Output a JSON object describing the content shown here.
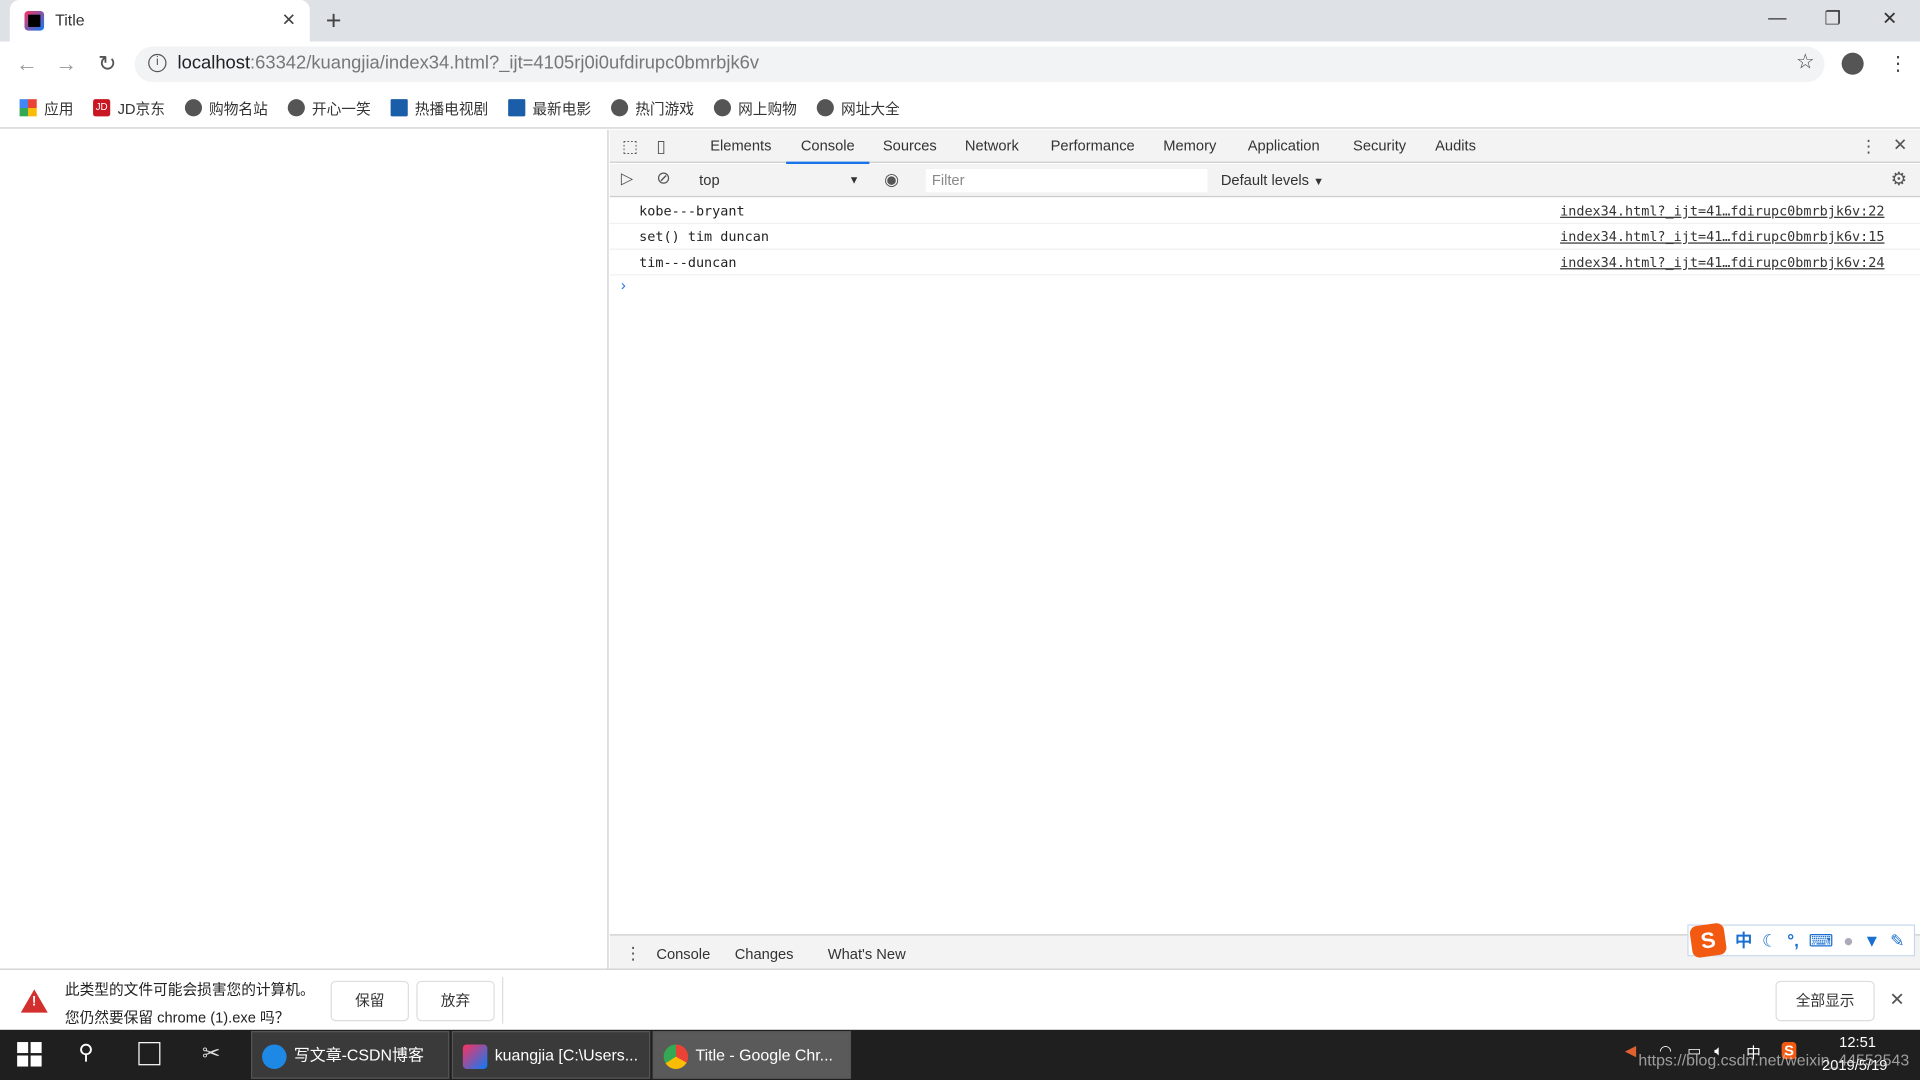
{
  "browser": {
    "tab_title": "Title",
    "url_host": "localhost",
    "url_rest": ":63342/kuangjia/index34.html?_ijt=4105rj0i0ufdirupc0bmrbjk6v",
    "bookmarks": [
      "应用",
      "JD京东",
      "购物名站",
      "开心一笑",
      "热播电视剧",
      "最新电影",
      "热门游戏",
      "网上购物",
      "网址大全"
    ]
  },
  "devtools": {
    "tabs": [
      "Elements",
      "Console",
      "Sources",
      "Network",
      "Performance",
      "Memory",
      "Application",
      "Security",
      "Audits"
    ],
    "active_tab": "Console",
    "context": "top",
    "filter_placeholder": "Filter",
    "levels": "Default levels",
    "messages": [
      {
        "text": "kobe---bryant",
        "source": "index34.html?_ijt=41…fdirupc0bmrbjk6v:22"
      },
      {
        "text": "set() tim duncan",
        "source": "index34.html?_ijt=41…fdirupc0bmrbjk6v:15"
      },
      {
        "text": "tim---duncan",
        "source": "index34.html?_ijt=41…fdirupc0bmrbjk6v:24"
      }
    ],
    "drawer_tabs": [
      "Console",
      "Changes",
      "What's New"
    ]
  },
  "download_bar": {
    "line1": "此类型的文件可能会损害您的计算机。",
    "line2": "您仍然要保留 chrome (1).exe 吗？",
    "keep": "保留",
    "discard": "放弃",
    "show_all": "全部显示"
  },
  "ime": {
    "mode": "中"
  },
  "taskbar": {
    "items": [
      "写文章-CSDN博客",
      "kuangjia [C:\\Users...",
      "Title - Google Chr..."
    ],
    "tray_lang": "中",
    "time": "12:51",
    "date": "2019/5/19"
  },
  "watermark": "https://blog.csdn.net/weixin_44552543",
  "colors": {
    "accent": "#1a73e8",
    "taskbar": "#1f1f1f",
    "warning": "#d32f2f"
  }
}
